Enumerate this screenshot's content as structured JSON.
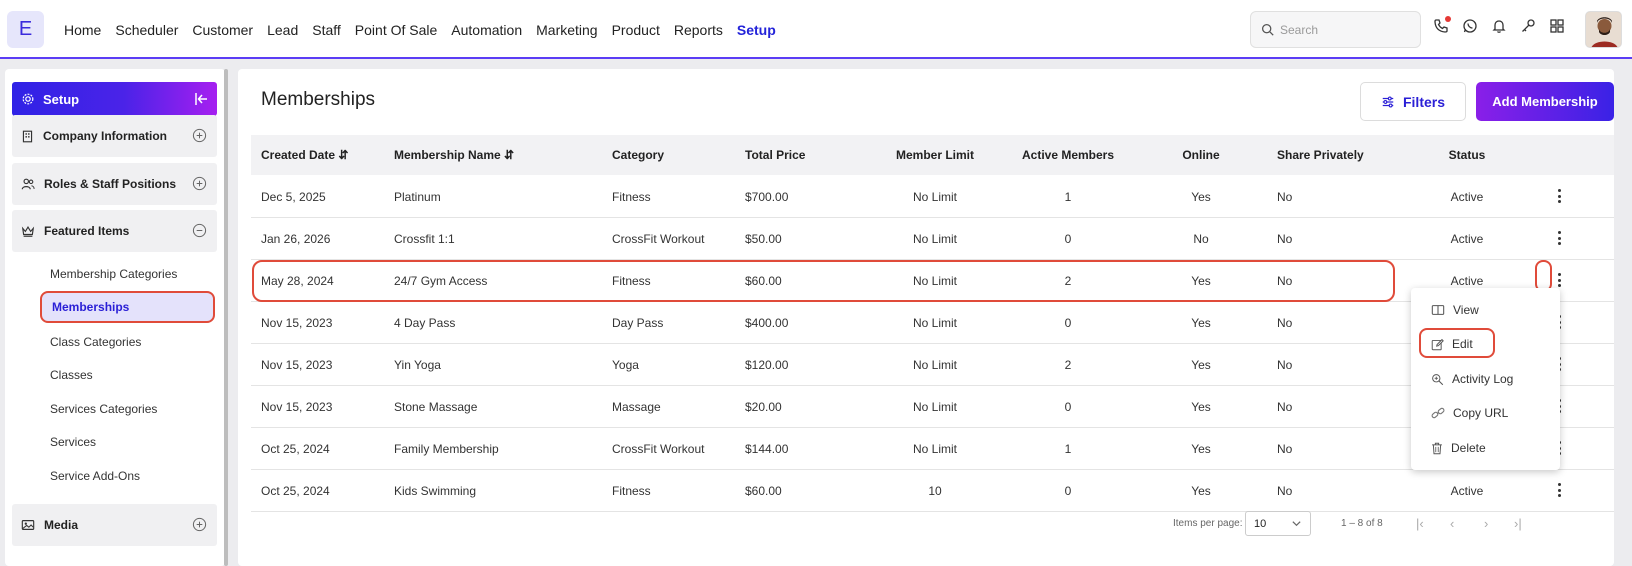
{
  "app": {
    "logo_letter": "E"
  },
  "nav": {
    "items": [
      "Home",
      "Scheduler",
      "Customer",
      "Lead",
      "Staff",
      "Point Of Sale",
      "Automation",
      "Marketing",
      "Product",
      "Reports",
      "Setup"
    ],
    "active": "Setup"
  },
  "search": {
    "placeholder": "Search"
  },
  "top_icons": [
    "phone-icon",
    "whatsapp-icon",
    "bell-icon",
    "key-icon",
    "apps-grid-icon"
  ],
  "sidebar": {
    "header": "Setup",
    "sections": [
      {
        "label": "Company Information",
        "icon": "building-icon",
        "expanded": false
      },
      {
        "label": "Roles & Staff Positions",
        "icon": "users-icon",
        "expanded": false
      },
      {
        "label": "Featured Items",
        "icon": "crown-icon",
        "expanded": true
      },
      {
        "label": "Media",
        "icon": "media-icon",
        "expanded": false
      }
    ],
    "featured_items": [
      "Membership Categories",
      "Memberships",
      "Class Categories",
      "Classes",
      "Services Categories",
      "Services",
      "Service Add-Ons"
    ],
    "active_item": "Memberships"
  },
  "page": {
    "title": "Memberships",
    "filters_label": "Filters",
    "add_label": "Add Membership"
  },
  "table": {
    "columns": [
      "Created Date",
      "Membership Name",
      "Category",
      "Total Price",
      "Member Limit",
      "Active Members",
      "Online",
      "Share Privately",
      "Status"
    ],
    "sortable": [
      "Created Date",
      "Membership Name"
    ],
    "rows": [
      [
        "Dec 5, 2025",
        "Platinum",
        "Fitness",
        "$700.00",
        "No Limit",
        "1",
        "Yes",
        "No",
        "Active"
      ],
      [
        "Jan 26, 2026",
        "Crossfit 1:1",
        "CrossFit Workout",
        "$50.00",
        "No Limit",
        "0",
        "No",
        "No",
        "Active"
      ],
      [
        "May 28, 2024",
        "24/7 Gym Access",
        "Fitness",
        "$60.00",
        "No Limit",
        "2",
        "Yes",
        "No",
        "Active"
      ],
      [
        "Nov 15, 2023",
        "4 Day Pass",
        "Day Pass",
        "$400.00",
        "No Limit",
        "0",
        "Yes",
        "No",
        ""
      ],
      [
        "Nov 15, 2023",
        "Yin Yoga",
        "Yoga",
        "$120.00",
        "No Limit",
        "2",
        "Yes",
        "No",
        ""
      ],
      [
        "Nov 15, 2023",
        "Stone Massage",
        "Massage",
        "$20.00",
        "No Limit",
        "0",
        "Yes",
        "No",
        ""
      ],
      [
        "Oct 25, 2024",
        "Family Membership",
        "CrossFit Workout",
        "$144.00",
        "No Limit",
        "1",
        "Yes",
        "No",
        ""
      ],
      [
        "Oct 25, 2024",
        "Kids Swimming",
        "Fitness",
        "$60.00",
        "10",
        "0",
        "Yes",
        "No",
        "Active"
      ]
    ]
  },
  "context_menu": {
    "items": [
      {
        "label": "View",
        "icon": "book-open-icon"
      },
      {
        "label": "Edit",
        "icon": "edit-icon"
      },
      {
        "label": "Activity Log",
        "icon": "zoom-icon"
      },
      {
        "label": "Copy URL",
        "icon": "link-icon"
      },
      {
        "label": "Delete",
        "icon": "trash-icon"
      }
    ]
  },
  "pagination": {
    "items_per_page_label": "Items per page:",
    "items_per_page": "10",
    "range": "1 – 8 of 8"
  },
  "colors": {
    "accent": "#2a1fd6",
    "highlight": "#e04b3a",
    "gradient_start": "#2f22e6",
    "gradient_end": "#a61ff0"
  }
}
